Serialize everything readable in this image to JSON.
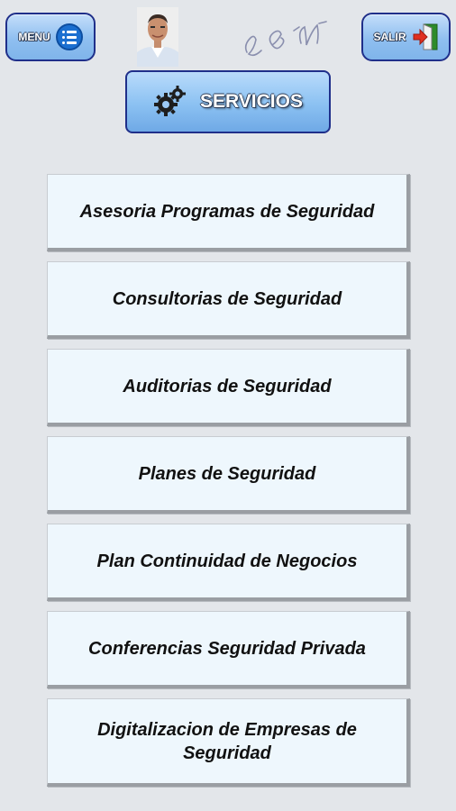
{
  "header": {
    "menu_label": "MENU",
    "exit_label": "SALIR",
    "title": "SERVICIOS"
  },
  "signature_text": "LGN",
  "services": [
    {
      "label": "Asesoria Programas de Seguridad"
    },
    {
      "label": "Consultorias de Seguridad"
    },
    {
      "label": "Auditorias de Seguridad"
    },
    {
      "label": "Planes de Seguridad"
    },
    {
      "label": "Plan Continuidad de Negocios"
    },
    {
      "label": "Conferencias Seguridad Privada"
    },
    {
      "label": "Digitalizacion de Empresas de Seguridad"
    }
  ],
  "colors": {
    "background": "#e3e6ea",
    "header_button": "#8fbff0",
    "header_border": "#1f2f8a",
    "service_button": "#eef7fd"
  }
}
